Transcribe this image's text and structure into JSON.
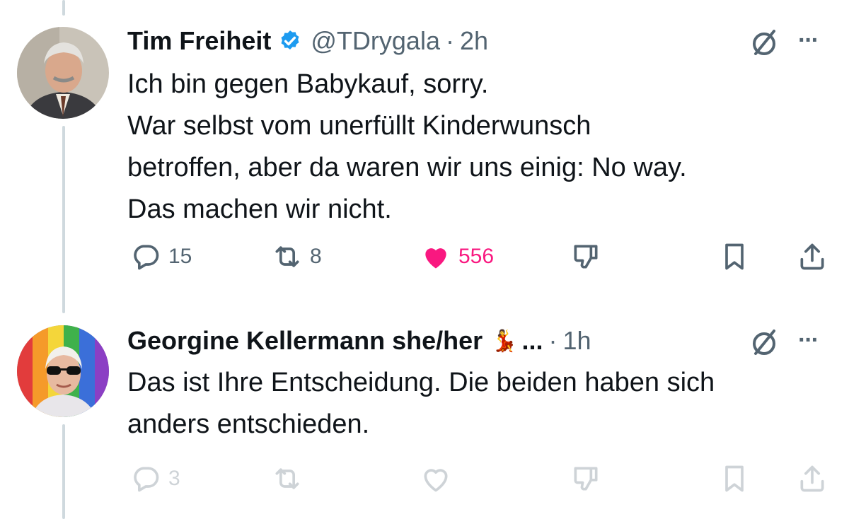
{
  "tweets": [
    {
      "author_name": "Tim Freiheit",
      "verified": true,
      "handle": "@TDrygala",
      "dot": "·",
      "time": "2h",
      "lines": [
        "Ich bin gegen Babykauf, sorry.",
        "War selbst vom unerfüllt Kinderwunsch",
        "betroffen, aber da waren wir uns einig: No way.",
        "Das machen wir nicht."
      ],
      "more_label": "···",
      "actions": {
        "replies": "15",
        "reposts": "8",
        "likes": "556",
        "liked": true
      }
    },
    {
      "author_name": "Georgine Kellermann she/her",
      "name_emoji": "💃",
      "name_ellipsis": "...",
      "dot": "·",
      "time": "1h",
      "lines": [
        "Das ist Ihre Entscheidung. Die beiden haben sich",
        "anders entschieden."
      ],
      "more_label": "···",
      "actions": {
        "replies": "3",
        "reposts": "",
        "likes": ""
      }
    }
  ],
  "colors": {
    "text": "#0f1419",
    "secondary": "#536471",
    "like_active": "#f91880",
    "verified_blue": "#1d9bf0",
    "thread_line": "#cfd9de"
  },
  "icons": [
    "reply-icon",
    "repost-icon",
    "like-icon",
    "dislike-icon",
    "bookmark-icon",
    "share-icon",
    "grok-icon",
    "more-icon",
    "verified-badge-icon"
  ]
}
